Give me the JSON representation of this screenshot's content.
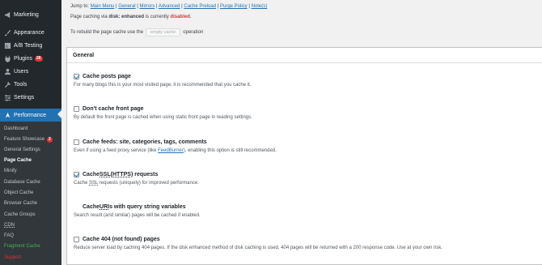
{
  "sidebar": {
    "top_items": [
      {
        "label": "Marketing",
        "icon": "megaphone-icon"
      },
      {
        "label": "Appearance",
        "icon": "paintbrush-icon"
      },
      {
        "label": "A/B Testing",
        "icon": "ab-icon"
      },
      {
        "label": "Plugins",
        "icon": "plug-icon",
        "badge": "26"
      },
      {
        "label": "Users",
        "icon": "user-icon"
      },
      {
        "label": "Tools",
        "icon": "wrench-icon"
      },
      {
        "label": "Settings",
        "icon": "settings-icon"
      },
      {
        "label": "Performance",
        "icon": "performance-icon"
      }
    ],
    "submenu": [
      {
        "label": "Dashboard"
      },
      {
        "label": "Feature Showcase",
        "badge": "2"
      },
      {
        "label": "General Settings"
      },
      {
        "label": "Page Cache"
      },
      {
        "label": "Minify"
      },
      {
        "label": "Database Cache"
      },
      {
        "label": "Object Cache"
      },
      {
        "label": "Browser Cache"
      },
      {
        "label": "Cache Groups"
      },
      {
        "label": "CDN"
      },
      {
        "label": "FAQ"
      },
      {
        "label": "Fragment Cache"
      },
      {
        "label": "Support"
      }
    ]
  },
  "jump": {
    "prefix": "Jump to:",
    "links": [
      "Main Menu",
      "General",
      "Mirrors",
      "Advanced",
      "Cache Preload",
      "Purge Policy",
      "Note(s)"
    ]
  },
  "status": {
    "prefix": "Page caching via",
    "mode": "disk: enhanced",
    "middle": "is currently",
    "state": "disabled"
  },
  "rebuild": {
    "prefix": "To rebuild the page cache use the",
    "button": "empty cache",
    "suffix": "operation"
  },
  "panel": {
    "title": "General",
    "options": [
      {
        "label": "Cache posts page",
        "checked": true,
        "desc": "For many blogs this is your most visited page, it is recommended that you cache it."
      },
      {
        "label": "Don't cache front page",
        "checked": false,
        "desc": "By default the front page is cached when using static front page in reading settings."
      },
      {
        "label": "Cache feeds: site, categories, tags, comments",
        "checked": false,
        "desc_pre": "Even if using a feed proxy service (like ",
        "desc_link": "FeedBurner",
        "desc_post": "), enabling this option is still recommended."
      },
      {
        "label_pre": "Cache ",
        "label_abbr": "SSL",
        "label_mid": " (",
        "label_abbr2": "HTTPS",
        "label_post": ") requests",
        "checked": true,
        "desc_pre": "Cache ",
        "desc_abbr": "SSL",
        "desc_post": " requests (uniquely) for improved performance."
      },
      {
        "label_pre": "Cache ",
        "label_abbr": "URI",
        "label_post": "s with query string variables",
        "checked": false,
        "desc": "Search result (and similar) pages will be cached if enabled."
      },
      {
        "label": "Cache 404 (not found) pages",
        "checked": false,
        "desc": "Reduce server load by caching 404 pages. If the disk enhanced method of disk caching is used, 404 pages will be returned with a 200 response code. Use at your own risk."
      }
    ]
  },
  "colors": {
    "sidebar": "#23282d",
    "submenu": "#32373c",
    "accent": "#2271b1",
    "badge": "#d63638",
    "disabled": "#d63638"
  }
}
